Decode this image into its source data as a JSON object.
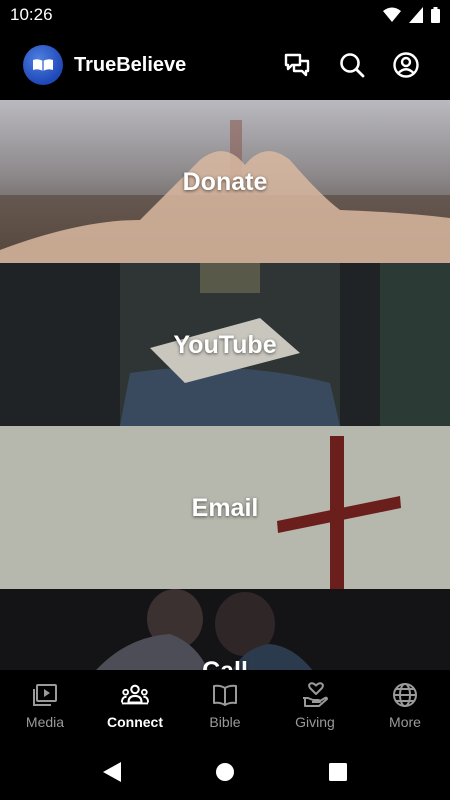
{
  "status": {
    "time": "10:26"
  },
  "app": {
    "title": "TrueBelieve"
  },
  "tiles": [
    {
      "label": "Donate"
    },
    {
      "label": "YouTube"
    },
    {
      "label": "Email"
    },
    {
      "label": "Call"
    }
  ],
  "nav": [
    {
      "label": "Media",
      "icon": "play-icon",
      "active": false
    },
    {
      "label": "Connect",
      "icon": "people-icon",
      "active": true
    },
    {
      "label": "Bible",
      "icon": "book-icon",
      "active": false
    },
    {
      "label": "Giving",
      "icon": "hand-heart-icon",
      "active": false
    },
    {
      "label": "More",
      "icon": "globe-icon",
      "active": false
    }
  ],
  "colors": {
    "accent": "#2a56c6",
    "nav_inactive": "#9a9a9a",
    "nav_active": "#ffffff"
  }
}
